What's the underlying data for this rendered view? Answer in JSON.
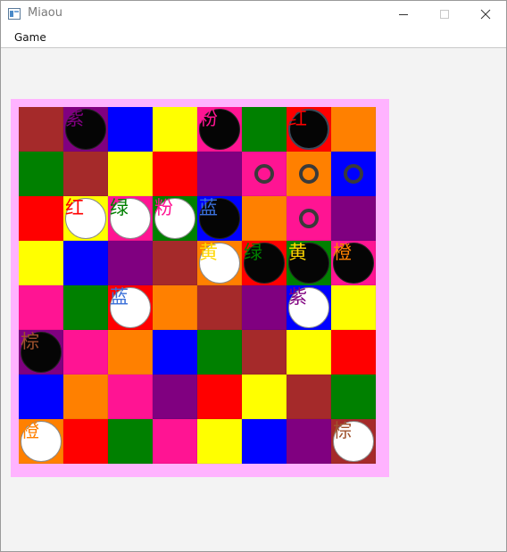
{
  "window": {
    "title": "Miaou"
  },
  "menu": {
    "game_label": "Game"
  },
  "palette": {
    "brown": "#a52a2a",
    "purple": "#800080",
    "blue": "#0000ff",
    "yellow": "#ffff00",
    "pink": "#ff1493",
    "green": "#008000",
    "red": "#ff0000",
    "orange": "#ff8000"
  },
  "board": {
    "frame_color": "#ffb3ff",
    "rows": [
      [
        "brown",
        "purple",
        "blue",
        "yellow",
        "pink",
        "green",
        "red",
        "orange"
      ],
      [
        "green",
        "brown",
        "yellow",
        "red",
        "purple",
        "pink",
        "orange",
        "blue"
      ],
      [
        "red",
        "yellow",
        "pink",
        "green",
        "blue",
        "orange",
        "pink",
        "purple"
      ],
      [
        "yellow",
        "blue",
        "purple",
        "brown",
        "orange",
        "red",
        "green",
        "pink"
      ],
      [
        "pink",
        "green",
        "red",
        "orange",
        "brown",
        "purple",
        "blue",
        "yellow"
      ],
      [
        "purple",
        "pink",
        "orange",
        "blue",
        "green",
        "brown",
        "yellow",
        "red"
      ],
      [
        "blue",
        "orange",
        "pink",
        "purple",
        "red",
        "yellow",
        "brown",
        "green"
      ],
      [
        "orange",
        "red",
        "green",
        "pink",
        "yellow",
        "blue",
        "purple",
        "brown"
      ]
    ],
    "pieces": [
      {
        "side": "black",
        "row": 0,
        "col": 1,
        "label": "紫",
        "label_color": "#800080"
      },
      {
        "side": "black",
        "row": 0,
        "col": 4,
        "label": "粉",
        "label_color": "#ff1493"
      },
      {
        "side": "black",
        "row": 0,
        "col": 6,
        "label": "红",
        "label_color": "#ff0000",
        "selected": true
      },
      {
        "side": "white",
        "row": 2,
        "col": 1,
        "label": "红",
        "label_color": "#ff0000"
      },
      {
        "side": "white",
        "row": 2,
        "col": 2,
        "label": "绿",
        "label_color": "#008000"
      },
      {
        "side": "white",
        "row": 2,
        "col": 3,
        "label": "粉",
        "label_color": "#ff1493"
      },
      {
        "side": "black",
        "row": 2,
        "col": 4,
        "label": "蓝",
        "label_color": "#3a6fd8"
      },
      {
        "side": "white",
        "row": 3,
        "col": 4,
        "label": "黄",
        "label_color": "#ffd700"
      },
      {
        "side": "black",
        "row": 3,
        "col": 5,
        "label": "绿",
        "label_color": "#008000"
      },
      {
        "side": "black",
        "row": 3,
        "col": 6,
        "label": "黄",
        "label_color": "#ffd700"
      },
      {
        "side": "black",
        "row": 3,
        "col": 7,
        "label": "橙",
        "label_color": "#ff8000"
      },
      {
        "side": "white",
        "row": 4,
        "col": 2,
        "label": "蓝",
        "label_color": "#3a6fd8"
      },
      {
        "side": "white",
        "row": 4,
        "col": 6,
        "label": "紫",
        "label_color": "#800080"
      },
      {
        "side": "black",
        "row": 5,
        "col": 0,
        "label": "棕",
        "label_color": "#a0522d"
      },
      {
        "side": "white",
        "row": 7,
        "col": 0,
        "label": "橙",
        "label_color": "#ff8000"
      },
      {
        "side": "white",
        "row": 7,
        "col": 7,
        "label": "棕",
        "label_color": "#a0522d"
      }
    ],
    "move_targets": [
      {
        "row": 1,
        "col": 5
      },
      {
        "row": 1,
        "col": 6
      },
      {
        "row": 1,
        "col": 7
      },
      {
        "row": 2,
        "col": 6
      }
    ]
  }
}
